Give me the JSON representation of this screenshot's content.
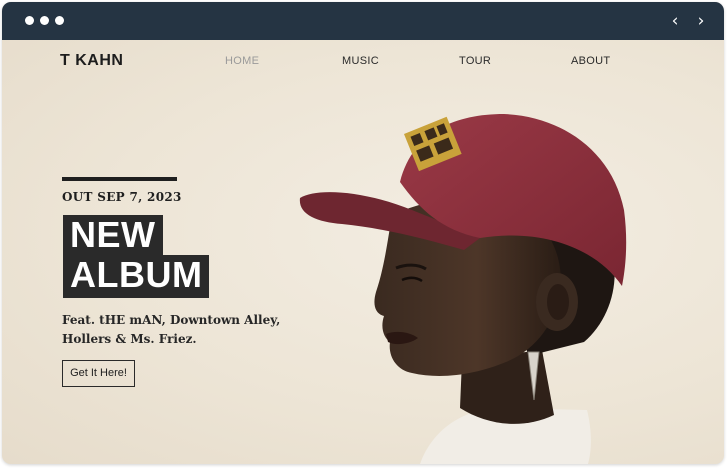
{
  "browser": {
    "back_glyph": "‹",
    "forward_glyph": "›"
  },
  "site": {
    "brand": "T KAHN",
    "nav": [
      {
        "label": "HOME",
        "active": true
      },
      {
        "label": "MUSIC",
        "active": false
      },
      {
        "label": "TOUR",
        "active": false
      },
      {
        "label": "ABOUT",
        "active": false
      }
    ]
  },
  "hero": {
    "date": "OUT SEP 7, 2023",
    "title_line1": "NEW",
    "title_line2": "ALBUM",
    "featuring": "Feat. tHE mAN, Downtown Alley, Hollers & Ms. Friez.",
    "cta": "Get It Here!",
    "photo": "portrait-red-cap"
  },
  "colors": {
    "chrome": "#253443",
    "background": "#ede5d6",
    "text": "#1f1f1f",
    "accent_cap": "#8c2f3b"
  }
}
